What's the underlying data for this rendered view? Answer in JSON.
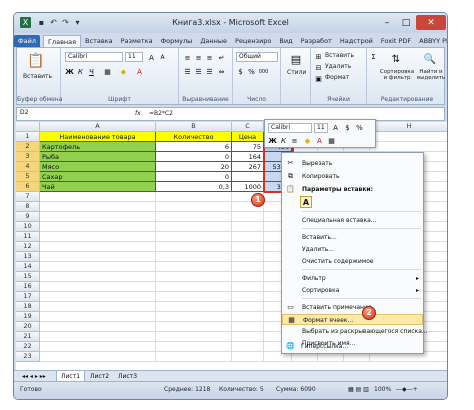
{
  "title": "Книга3.xlsx - Microsoft Excel",
  "tabs": [
    "Файл",
    "Главная",
    "Вставка",
    "Разметка",
    "Формулы",
    "Данные",
    "Рецензиро",
    "Вид",
    "Разработ",
    "Надстрой",
    "Foxit PDF",
    "ABBYY PI"
  ],
  "ribbon": {
    "paste": "Вставить",
    "clipboard": "Буфер обмена",
    "font_name": "Calibri",
    "font_size": "11",
    "bold": "Ж",
    "italic": "К",
    "underline": "Ч",
    "font_group": "Шрифт",
    "align_group": "Выравнивание",
    "number_format": "Общий",
    "number_group": "Число",
    "styles": "Стили",
    "insert": "Вставить",
    "delete": "Удалить",
    "format": "Формат",
    "cells_group": "Ячейки",
    "sort_filter": "Сортировка и фильтр",
    "find_select": "Найти и выделить",
    "edit_group": "Редактирование"
  },
  "formula_bar": {
    "name_box": "D2",
    "fx": "fx",
    "formula": "=B2*C2"
  },
  "columns": [
    "A",
    "B",
    "C",
    "D",
    "E",
    "F",
    "G",
    "H"
  ],
  "rows": [
    "1",
    "2",
    "3",
    "4",
    "5",
    "6",
    "7",
    "8",
    "9",
    "10",
    "11",
    "12",
    "13",
    "14",
    "15",
    "16",
    "17",
    "18",
    "19",
    "20",
    "21",
    "22",
    "23"
  ],
  "table": {
    "headers": [
      "Наименование товара",
      "Количество",
      "Цена",
      "Сумма"
    ],
    "rows": [
      [
        "Картофель",
        "6",
        "75",
        "450"
      ],
      [
        "Рыба",
        "0",
        "164",
        "0"
      ],
      [
        "Мясо",
        "20",
        "267",
        "5340"
      ],
      [
        "Сахар",
        "0",
        "",
        "0"
      ],
      [
        "Чай",
        "0,3",
        "1000",
        "300"
      ]
    ]
  },
  "minibar": {
    "font": "Calibri",
    "size": "11"
  },
  "context_menu": {
    "cut": "Вырезать",
    "copy": "Копировать",
    "paste_options": "Параметры вставки:",
    "paste_special": "Специальная вставка...",
    "insert": "Вставить...",
    "delete": "Удалить...",
    "clear": "Очистить содержимое",
    "filter": "Фильтр",
    "sort": "Сортировка",
    "insert_comment": "Вставить примечание",
    "format_cells": "Формат ячеек...",
    "pick_list": "Выбрать из раскрывающегося списка...",
    "name": "Присвоить имя...",
    "hyperlink": "Гиперссылка..."
  },
  "callouts": [
    "1",
    "2"
  ],
  "sheets": [
    "Лист1",
    "Лист2",
    "Лист3"
  ],
  "status": {
    "ready": "Готово",
    "average": "Среднее: 1218",
    "count": "Количество: 5",
    "sum": "Сумма: 6090",
    "zoom": "100%"
  },
  "colors": {
    "header_fill": "#ffff00",
    "name_fill": "#92d050",
    "sum_fill": "#ffff00",
    "selection": "#c6d9f1",
    "accent": "#2d6bb6",
    "callout": "#d6311a"
  }
}
